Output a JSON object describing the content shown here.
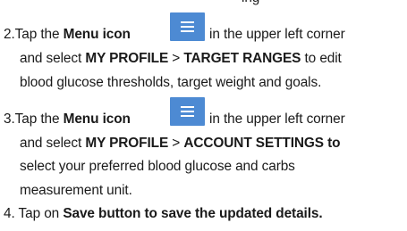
{
  "top_fragment": "ing",
  "steps": [
    {
      "num": "2.",
      "line1": {
        "a": "Tap the ",
        "b": "Menu icon",
        "c": " in the upper left corner"
      },
      "line2": {
        "a": "and select ",
        "b": "MY PROFILE",
        "c": " > ",
        "d": "TARGET RANGES",
        "e": " to edit"
      },
      "line3": "blood glucose thresholds, target weight and goals."
    },
    {
      "num": "3.",
      "line1": {
        "a": "Tap the ",
        "b": "Menu icon",
        "c": " in the upper left corner"
      },
      "line2": {
        "a": "and select ",
        "b": "MY PROFILE",
        "c": " > ",
        "d": "ACCOUNT SETTINGS to"
      },
      "line3": "select your preferred blood glucose and carbs",
      "line4": "measurement unit."
    },
    {
      "num": "4.",
      "line1": {
        "a": " Tap on ",
        "b": "Save button to save the updated details."
      }
    }
  ],
  "menu_icon": {
    "icon": "hamburger-menu-icon",
    "color": "#4d8ad3"
  }
}
